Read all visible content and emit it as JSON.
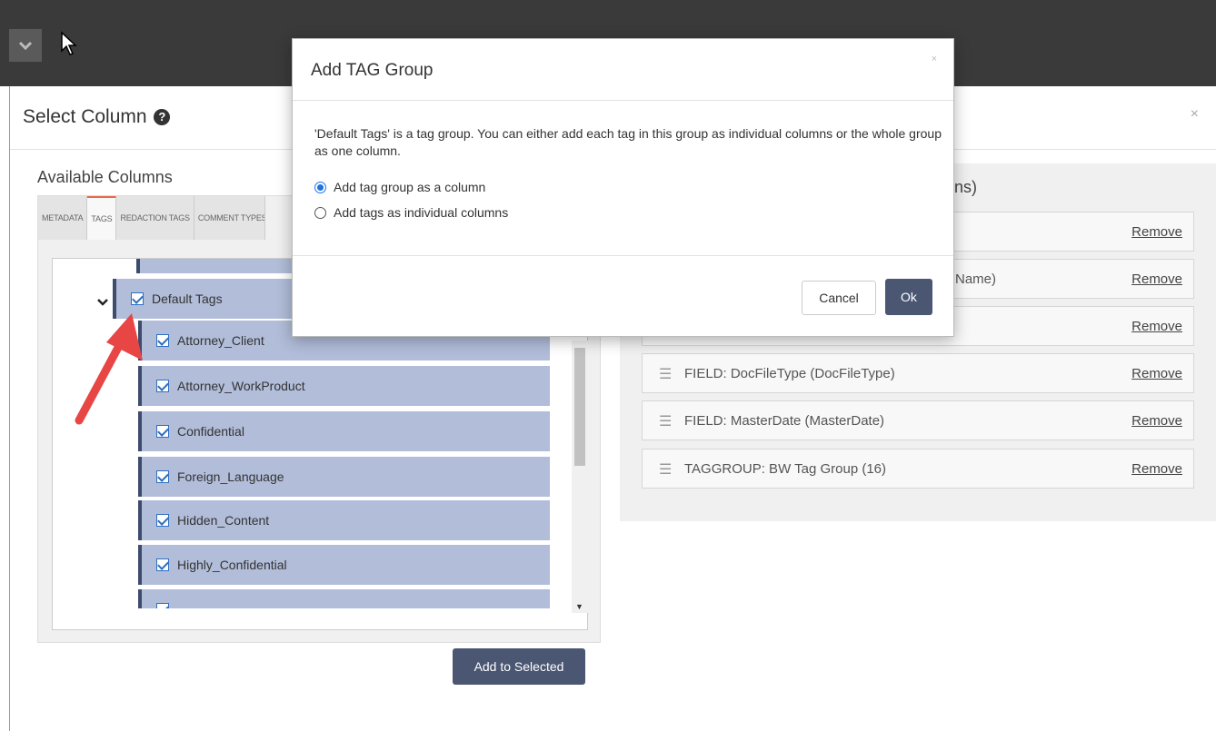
{
  "select_column": {
    "title": "Select Column",
    "help_icon_glyph": "?",
    "close_glyph": "×",
    "available_title": "Available Columns",
    "tabs": [
      "METADATA",
      "TAGS",
      "REDACTION TAGS",
      "COMMENT TYPES"
    ],
    "active_tab": "TAGS",
    "tree": {
      "group_label": "Default Tags",
      "items": [
        "Attorney_Client",
        "Attorney_WorkProduct",
        "Confidential",
        "Foreign_Language",
        "Hidden_Content",
        "Highly_Confidential"
      ]
    },
    "add_to_selected_label": "Add to Selected",
    "selected_title_fragment": "umns)",
    "selected_rows": [
      {
        "label": "",
        "remove": "Remove"
      },
      {
        "label": "Name)",
        "remove": "Remove"
      },
      {
        "label": "",
        "remove": "Remove"
      },
      {
        "label": "FIELD: DocFileType (DocFileType)",
        "remove": "Remove"
      },
      {
        "label": "FIELD: MasterDate (MasterDate)",
        "remove": "Remove"
      },
      {
        "label": "TAGGROUP: BW Tag Group (16)",
        "remove": "Remove"
      }
    ]
  },
  "dialog": {
    "title": "Add TAG Group",
    "close_glyph": "×",
    "message": "'Default Tags' is a tag group. You can either add each tag in this group as individual columns or the whole group as one column.",
    "options": [
      {
        "label": "Add tag group as a column",
        "selected": true
      },
      {
        "label": "Add tags as individual columns",
        "selected": false
      }
    ],
    "cancel_label": "Cancel",
    "ok_label": "Ok"
  },
  "colors": {
    "primary_button": "#4a5672",
    "tag_row": "#b1bdd9",
    "arrow": "#e84545",
    "radio_selected": "#1a73e8"
  }
}
